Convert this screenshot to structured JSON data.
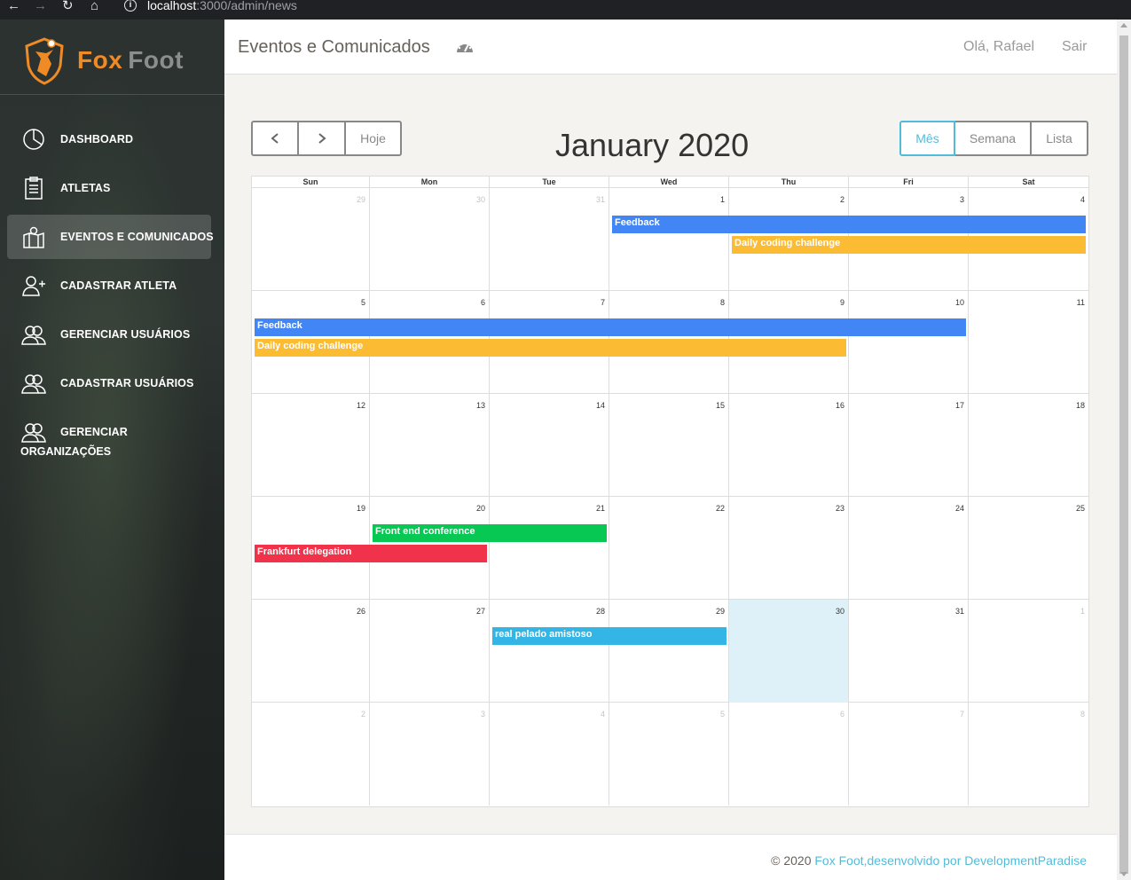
{
  "browser": {
    "url_host": "localhost",
    "url_path": ":3000/admin/news"
  },
  "brand": {
    "part1": "Fox",
    "part2": "Foot"
  },
  "sidebar": {
    "items": [
      {
        "label": "DASHBOARD",
        "icon": "pie-chart-icon",
        "active": false
      },
      {
        "label": "ATLETAS",
        "icon": "clipboard-icon",
        "active": false
      },
      {
        "label": "EVENTOS E COMUNICADOS",
        "icon": "map-pin-icon",
        "active": true
      },
      {
        "label": "CADASTRAR ATLETA",
        "icon": "add-user-icon",
        "active": false
      },
      {
        "label": "GERENCIAR USUÁRIOS",
        "icon": "users-icon",
        "active": false
      },
      {
        "label": "CADASTRAR USUÁRIOS",
        "icon": "users-icon",
        "active": false
      },
      {
        "label": "GERENCIAR",
        "label2": "ORGANIZAÇÕES",
        "icon": "users-icon",
        "active": false
      }
    ]
  },
  "header": {
    "title": "Eventos e Comunicados",
    "icon": "dashboard-gauge-icon",
    "greeting": "Olá, Rafael",
    "logout": "Sair"
  },
  "calendar": {
    "title": "January 2020",
    "today_label": "Hoje",
    "views": [
      "Mês",
      "Semana",
      "Lista"
    ],
    "active_view": "Mês",
    "weekdays": [
      "Sun",
      "Mon",
      "Tue",
      "Wed",
      "Thu",
      "Fri",
      "Sat"
    ],
    "weeks": [
      [
        "29",
        "30",
        "31",
        "1",
        "2",
        "3",
        "4"
      ],
      [
        "5",
        "6",
        "7",
        "8",
        "9",
        "10",
        "11"
      ],
      [
        "12",
        "13",
        "14",
        "15",
        "16",
        "17",
        "18"
      ],
      [
        "19",
        "20",
        "21",
        "22",
        "23",
        "24",
        "25"
      ],
      [
        "26",
        "27",
        "28",
        "29",
        "30",
        "31",
        "1"
      ],
      [
        "2",
        "3",
        "4",
        "5",
        "6",
        "7",
        "8"
      ]
    ],
    "today": "2020-01-30",
    "events": [
      {
        "title": "Feedback",
        "start": "2020-01-01",
        "end": "2020-01-10",
        "color": "#4285f4"
      },
      {
        "title": "Daily coding challenge",
        "start": "2020-01-02",
        "end": "2020-01-09",
        "color": "#fbbc34"
      },
      {
        "title": "Front end conference",
        "start": "2020-01-20",
        "end": "2020-01-21",
        "color": "#06c853"
      },
      {
        "title": "Frankfurt delegation",
        "start": "2020-01-19",
        "end": "2020-01-20",
        "color": "#f0324a"
      },
      {
        "title": "real pelado amistoso",
        "start": "2020-01-28",
        "end": "2020-01-29",
        "color": "#33b5e5"
      }
    ]
  },
  "footer": {
    "prefix": "© 2020",
    "link": "Fox Foot,desenvolvido por DevelopmentParadise"
  }
}
